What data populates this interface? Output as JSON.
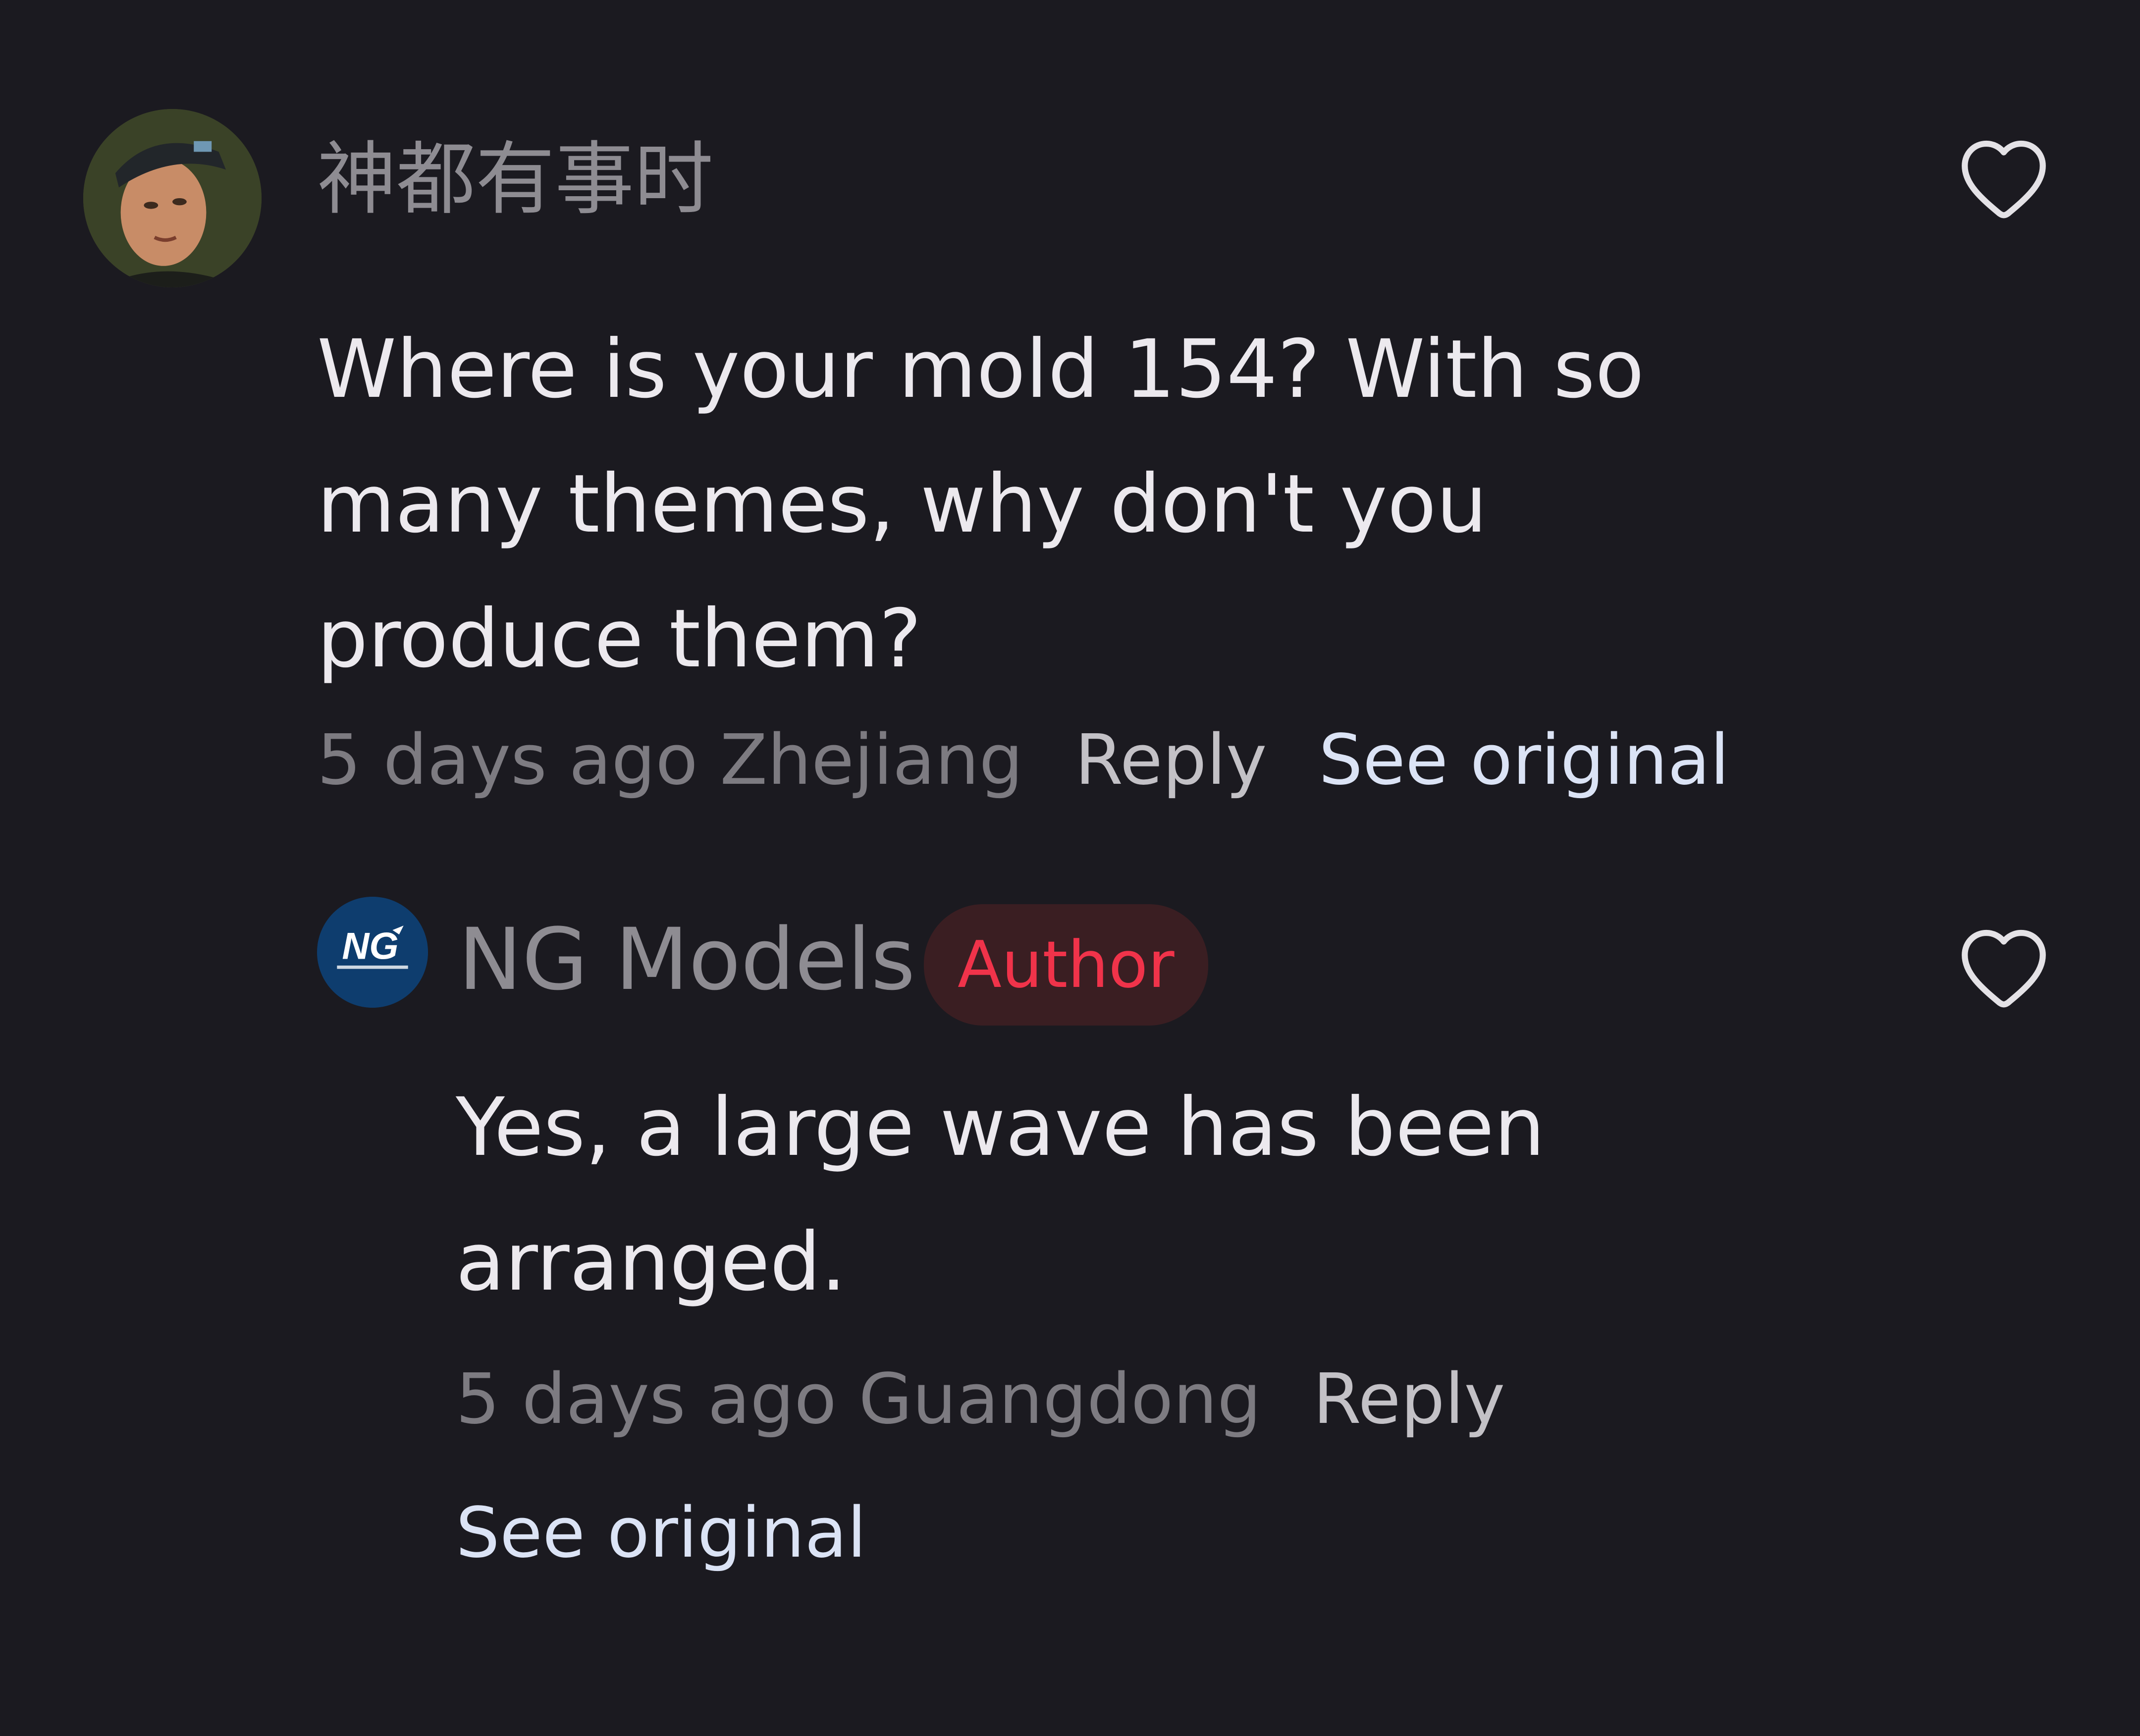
{
  "comment": {
    "username": "神都有事时",
    "text": "Where is your mold 154? With so many themes, why don't you produce them?",
    "time_location": "5 days ago Zhejiang",
    "reply_label": "Reply",
    "see_original_label": "See original",
    "avatar_icon": "user-photo-avatar",
    "like_icon": "heart-outline-icon"
  },
  "reply": {
    "username": "NG Models",
    "badge": "Author",
    "avatar_logo_text": "NG",
    "text": "Yes, a large wave has been arranged.",
    "time_location": "5 days ago Guangdong",
    "reply_label": "Reply",
    "see_original_label": "See original",
    "avatar_icon": "ng-models-logo",
    "like_icon": "heart-outline-icon"
  },
  "colors": {
    "background": "#1b1a20",
    "username": "#8e8c92",
    "body_text": "#ece9ee",
    "meta_text": "#7d7b81",
    "link_text": "#dbe3f5",
    "author_badge_text": "#f0334a",
    "author_badge_bg": "#3a1e22",
    "logo_bg": "#0e3d6e"
  }
}
